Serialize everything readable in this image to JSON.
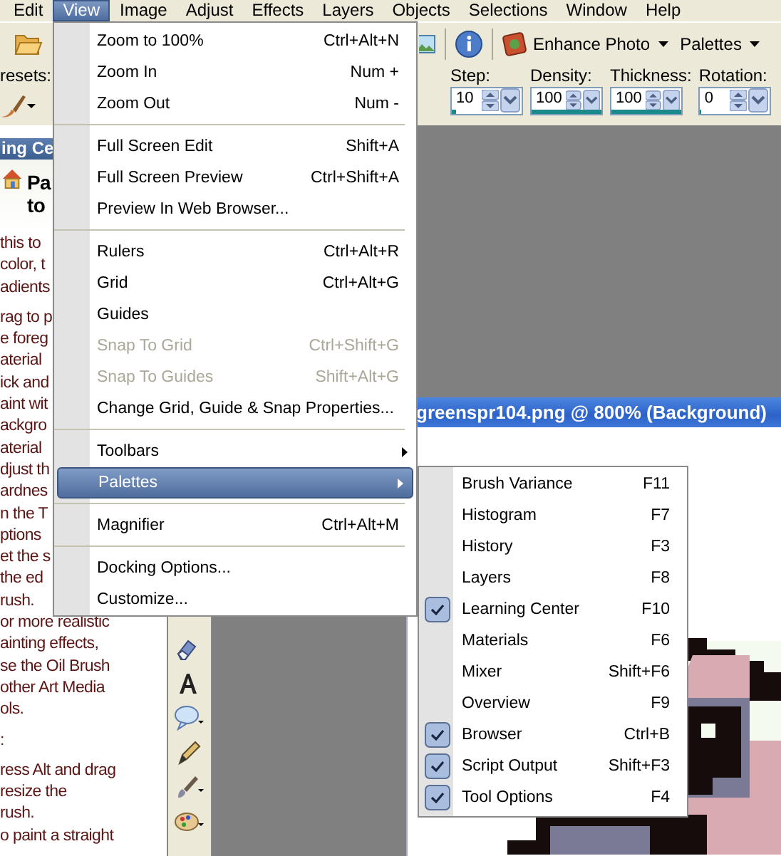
{
  "menu_bar": [
    {
      "label": "Edit",
      "selected": false
    },
    {
      "label": "View",
      "selected": true
    },
    {
      "label": "Image",
      "selected": false
    },
    {
      "label": "Adjust",
      "selected": false
    },
    {
      "label": "Effects",
      "selected": false
    },
    {
      "label": "Layers",
      "selected": false
    },
    {
      "label": "Objects",
      "selected": false
    },
    {
      "label": "Selections",
      "selected": false
    },
    {
      "label": "Window",
      "selected": false
    },
    {
      "label": "Help",
      "selected": false
    }
  ],
  "toolbar": {
    "buttons": [
      {
        "label": "Enhance Photo"
      },
      {
        "label": "Palettes"
      }
    ]
  },
  "tool_options": {
    "presets_label": "resets:",
    "fields": [
      {
        "label": "Step:",
        "value": "10",
        "level": 0.06
      },
      {
        "label": "Density:",
        "value": "100",
        "level": 1
      },
      {
        "label": "Thickness:",
        "value": "100",
        "level": 1
      },
      {
        "label": "Rotation:",
        "value": "0",
        "level": 0.02
      }
    ]
  },
  "learning_center": {
    "title": "ing Ce",
    "heading_lines": [
      "Pa",
      "to"
    ],
    "paragraphs": [
      [
        "this to",
        "color, t",
        "adients"
      ],
      [
        "rag to p",
        "e foreg",
        "aterial",
        "ick and",
        "aint wit",
        "ackgro",
        "aterial",
        "djust th",
        "ardnes",
        "n the T",
        "ptions",
        "et the s",
        "the ed",
        "rush.",
        "or more realistic",
        "ainting effects,",
        "se the Oil Brush",
        "other Art Media",
        "ols."
      ],
      [
        ":"
      ],
      [
        "ress Alt and drag",
        "resize the",
        "rush.",
        "o paint a straight"
      ]
    ]
  },
  "document": {
    "title": "greenspr104.png @ 800% (Background)"
  },
  "view_menu": {
    "items": [
      {
        "kind": "item",
        "label": "Zoom to 100%",
        "shortcut": "Ctrl+Alt+N",
        "disabled": false,
        "selected": false,
        "submenu": false
      },
      {
        "kind": "item",
        "label": "Zoom In",
        "shortcut": "Num +",
        "disabled": false,
        "selected": false,
        "submenu": false
      },
      {
        "kind": "item",
        "label": "Zoom Out",
        "shortcut": "Num -",
        "disabled": false,
        "selected": false,
        "submenu": false
      },
      {
        "kind": "separator"
      },
      {
        "kind": "item",
        "label": "Full Screen Edit",
        "shortcut": "Shift+A",
        "disabled": false,
        "selected": false,
        "submenu": false
      },
      {
        "kind": "item",
        "label": "Full Screen Preview",
        "shortcut": "Ctrl+Shift+A",
        "disabled": false,
        "selected": false,
        "submenu": false
      },
      {
        "kind": "item",
        "label": "Preview In Web Browser...",
        "disabled": false,
        "selected": false,
        "submenu": false
      },
      {
        "kind": "separator"
      },
      {
        "kind": "item",
        "label": "Rulers",
        "shortcut": "Ctrl+Alt+R",
        "disabled": false,
        "selected": false,
        "submenu": false
      },
      {
        "kind": "item",
        "label": "Grid",
        "shortcut": "Ctrl+Alt+G",
        "disabled": false,
        "selected": false,
        "submenu": false
      },
      {
        "kind": "item",
        "label": "Guides",
        "disabled": false,
        "selected": false,
        "submenu": false
      },
      {
        "kind": "item",
        "label": "Snap To Grid",
        "shortcut": "Ctrl+Shift+G",
        "disabled": true,
        "selected": false,
        "submenu": false
      },
      {
        "kind": "item",
        "label": "Snap To Guides",
        "shortcut": "Shift+Alt+G",
        "disabled": true,
        "selected": false,
        "submenu": false
      },
      {
        "kind": "item",
        "label": "Change Grid, Guide & Snap Properties...",
        "disabled": false,
        "selected": false,
        "submenu": false
      },
      {
        "kind": "separator"
      },
      {
        "kind": "item",
        "label": "Toolbars",
        "disabled": false,
        "selected": false,
        "submenu": true
      },
      {
        "kind": "item",
        "label": "Palettes",
        "disabled": false,
        "selected": true,
        "submenu": true
      },
      {
        "kind": "separator"
      },
      {
        "kind": "item",
        "label": "Magnifier",
        "shortcut": "Ctrl+Alt+M",
        "disabled": false,
        "selected": false,
        "submenu": false
      },
      {
        "kind": "separator"
      },
      {
        "kind": "item",
        "label": "Docking Options...",
        "disabled": false,
        "selected": false,
        "submenu": false
      },
      {
        "kind": "item",
        "label": "Customize...",
        "disabled": false,
        "selected": false,
        "submenu": false
      }
    ]
  },
  "palettes_menu": {
    "items": [
      {
        "label": "Brush Variance",
        "shortcut": "F11",
        "checked": false
      },
      {
        "label": "Histogram",
        "shortcut": "F7",
        "checked": false
      },
      {
        "label": "History",
        "shortcut": "F3",
        "checked": false
      },
      {
        "label": "Layers",
        "shortcut": "F8",
        "checked": false
      },
      {
        "label": "Learning Center",
        "shortcut": "F10",
        "checked": true
      },
      {
        "label": "Materials",
        "shortcut": "F6",
        "checked": false
      },
      {
        "label": "Mixer",
        "shortcut": "Shift+F6",
        "checked": false
      },
      {
        "label": "Overview",
        "shortcut": "F9",
        "checked": false
      },
      {
        "label": "Browser",
        "shortcut": "Ctrl+B",
        "checked": true
      },
      {
        "label": "Script Output",
        "shortcut": "Shift+F3",
        "checked": true
      },
      {
        "label": "Tool Options",
        "shortcut": "F4",
        "checked": true
      }
    ]
  }
}
